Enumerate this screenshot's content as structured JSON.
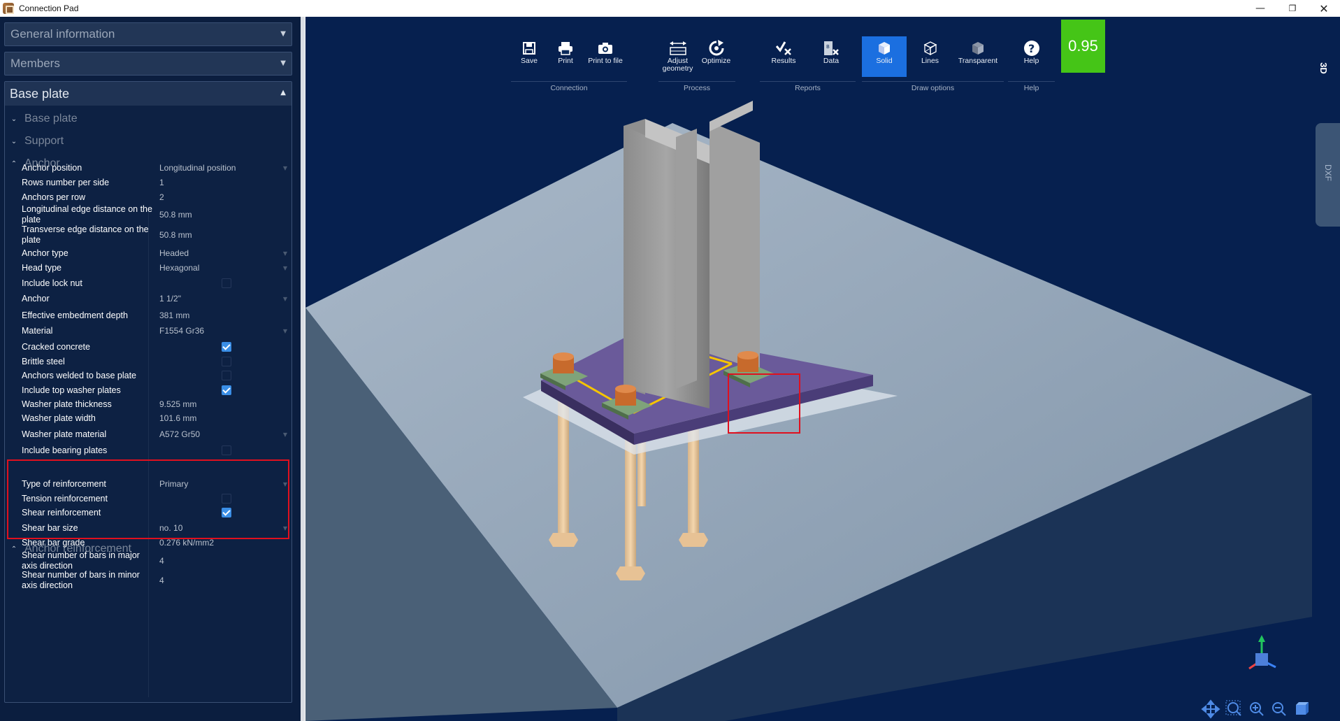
{
  "window": {
    "title": "Connection Pad",
    "minimize": "—",
    "maximize": "❐",
    "close": "✕"
  },
  "sidebar": {
    "sections": [
      {
        "label": "General information"
      },
      {
        "label": "Members"
      }
    ],
    "base_plate": {
      "label": "Base plate",
      "subsections": {
        "base_plate": "Base plate",
        "support": "Support",
        "anchor": "Anchor",
        "anchor_reinforcement": "Anchor reinforcement"
      },
      "anchor_props": [
        {
          "label": "Anchor position",
          "value": "Longitudinal position",
          "kind": "dropdown"
        },
        {
          "label": "Rows number per side",
          "value": "1",
          "kind": "text"
        },
        {
          "label": "Anchors per row",
          "value": "2",
          "kind": "text"
        },
        {
          "label": "Longitudinal edge distance on the plate",
          "value": "50.8 mm",
          "kind": "text"
        },
        {
          "label": "Transverse edge distance on the plate",
          "value": "50.8 mm",
          "kind": "text"
        },
        {
          "label": "Anchor type",
          "value": "Headed",
          "kind": "dropdown"
        },
        {
          "label": "Head type",
          "value": "Hexagonal",
          "kind": "dropdown"
        },
        {
          "label": "Include lock nut",
          "value": "",
          "kind": "checkbox",
          "checked": false
        },
        {
          "label": "Anchor",
          "value": "1 1/2\"",
          "kind": "dropdown"
        },
        {
          "label": "Effective embedment depth",
          "value": "381 mm",
          "kind": "text"
        },
        {
          "label": "Material",
          "value": "F1554 Gr36",
          "kind": "dropdown"
        },
        {
          "label": "Cracked concrete",
          "value": "",
          "kind": "checkbox",
          "checked": true
        },
        {
          "label": "Brittle steel",
          "value": "",
          "kind": "checkbox",
          "checked": false
        },
        {
          "label": "Anchors welded to base plate",
          "value": "",
          "kind": "checkbox",
          "checked": false
        },
        {
          "label": "Include top washer plates",
          "value": "",
          "kind": "checkbox",
          "checked": true
        },
        {
          "label": "Washer plate thickness",
          "value": "9.525 mm",
          "kind": "text"
        },
        {
          "label": "Washer plate width",
          "value": "101.6 mm",
          "kind": "text"
        },
        {
          "label": "Washer plate material",
          "value": "A572 Gr50",
          "kind": "dropdown"
        },
        {
          "label": "Include bearing plates",
          "value": "",
          "kind": "checkbox",
          "checked": false
        }
      ],
      "reinforcement_props": [
        {
          "label": "Type of reinforcement",
          "value": "Primary",
          "kind": "dropdown"
        },
        {
          "label": "Tension reinforcement",
          "value": "",
          "kind": "checkbox",
          "checked": false
        },
        {
          "label": "Shear reinforcement",
          "value": "",
          "kind": "checkbox",
          "checked": true
        },
        {
          "label": "Shear bar size",
          "value": "no. 10",
          "kind": "dropdown"
        },
        {
          "label": "Shear bar grade",
          "value": "0.276 kN/mm2",
          "kind": "text"
        },
        {
          "label": "Shear number of bars in major axis direction",
          "value": "4",
          "kind": "text"
        },
        {
          "label": "Shear number of bars in minor axis direction",
          "value": "4",
          "kind": "text"
        }
      ]
    }
  },
  "toolbar": {
    "groups": [
      {
        "label": "Connection",
        "buttons": [
          {
            "label": "Save",
            "icon": "save-icon"
          },
          {
            "label": "Print",
            "icon": "print-icon"
          },
          {
            "label": "Print to file",
            "icon": "camera-icon"
          }
        ]
      },
      {
        "label": "Process",
        "buttons": [
          {
            "label": "Adjust geometry",
            "icon": "adjust-geometry-icon"
          },
          {
            "label": "Optimize",
            "icon": "optimize-icon"
          }
        ]
      },
      {
        "label": "Reports",
        "buttons": [
          {
            "label": "Results",
            "icon": "results-icon"
          },
          {
            "label": "Data",
            "icon": "data-icon"
          }
        ]
      },
      {
        "label": "Draw options",
        "buttons": [
          {
            "label": "Solid",
            "icon": "solid-icon",
            "active": true
          },
          {
            "label": "Lines",
            "icon": "lines-icon"
          },
          {
            "label": "Transparent",
            "icon": "transparent-icon"
          }
        ]
      },
      {
        "label": "Help",
        "buttons": [
          {
            "label": "Help",
            "icon": "help-icon"
          }
        ]
      }
    ],
    "score": "0.95"
  },
  "viewport": {
    "view_mode": "3D",
    "dxf_tab": "DXF",
    "colors": {
      "background": "#06204f",
      "slab": "#8aa1b8",
      "plate": "#5a4a8a",
      "steel": "#9a9a9a",
      "anchor": "#f0cfa2",
      "nut": "#c76a2c",
      "washer": "#7fa37a",
      "weld": "#f5c400",
      "highlight": "#e0101e",
      "score": "#45c517"
    }
  }
}
